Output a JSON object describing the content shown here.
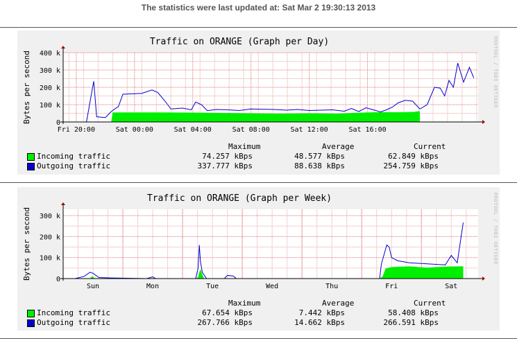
{
  "status": "The statistics were last updated at: Sat Mar 2 19:30:13 2013",
  "credit": "RRDTOOL / TOBI OETIKER",
  "legend_headers": {
    "max": "Maximum",
    "avg": "Average",
    "cur": "Current"
  },
  "colors": {
    "incoming": "#00ee00",
    "outgoing": "#0000cc",
    "grid": "#e8a0a0",
    "panel": "#f0f0f0"
  },
  "graphs": [
    {
      "title": "Traffic on ORANGE (Graph per Day)",
      "ylabel": "Bytes per second",
      "incoming": {
        "label": "Incoming traffic",
        "max": "74.257 kBps",
        "avg": "48.577 kBps",
        "cur": "62.849 kBps"
      },
      "outgoing": {
        "label": "Outgoing traffic",
        "max": "337.777 kBps",
        "avg": "88.638 kBps",
        "cur": "254.759 kBps"
      }
    },
    {
      "title": "Traffic on ORANGE (Graph per Week)",
      "ylabel": "Bytes per second",
      "incoming": {
        "label": "Incoming traffic",
        "max": "67.654 kBps",
        "avg": "7.442 kBps",
        "cur": "58.408 kBps"
      },
      "outgoing": {
        "label": "Outgoing traffic",
        "max": "267.766 kBps",
        "avg": "14.662 kBps",
        "cur": "266.591 kBps"
      }
    }
  ],
  "chart_data": [
    {
      "type": "area",
      "title": "Traffic on ORANGE (Graph per Day)",
      "ylabel": "Bytes per second",
      "ylim": [
        0,
        400000
      ],
      "y_ticks": [
        "0",
        "100 k",
        "200 k",
        "300 k",
        "400 k"
      ],
      "x_ticks": [
        "Fri 20:00",
        "Sat 00:00",
        "Sat 04:00",
        "Sat 08:00",
        "Sat 12:00",
        "Sat 16:00"
      ],
      "x_range_hours": [
        -0.9,
        23.6
      ],
      "series": [
        {
          "name": "Incoming traffic",
          "points": [
            [
              0.7,
              0
            ],
            [
              1.2,
              0
            ],
            [
              2.4,
              0
            ],
            [
              2.5,
              55000
            ],
            [
              4,
              55000
            ],
            [
              6,
              55000
            ],
            [
              8,
              54000
            ],
            [
              10,
              52000
            ],
            [
              12,
              50000
            ],
            [
              14,
              48000
            ],
            [
              16,
              50000
            ],
            [
              18,
              48000
            ],
            [
              19,
              52000
            ],
            [
              20,
              55000
            ],
            [
              21,
              57000
            ],
            [
              22,
              56000
            ],
            [
              23.2,
              58000
            ],
            [
              23.6,
              62849
            ]
          ]
        },
        {
          "name": "Outgoing traffic",
          "points": [
            [
              0.7,
              0
            ],
            [
              1.2,
              235000
            ],
            [
              1.4,
              30000
            ],
            [
              2,
              25000
            ],
            [
              2.4,
              60000
            ],
            [
              2.9,
              90000
            ],
            [
              3.2,
              160000
            ],
            [
              4.5,
              165000
            ],
            [
              5.2,
              185000
            ],
            [
              5.6,
              170000
            ],
            [
              6.1,
              120000
            ],
            [
              6.5,
              75000
            ],
            [
              7.3,
              80000
            ],
            [
              7.9,
              70000
            ],
            [
              8.2,
              115000
            ],
            [
              8.6,
              100000
            ],
            [
              9,
              65000
            ],
            [
              9.6,
              72000
            ],
            [
              10.4,
              70000
            ],
            [
              11.2,
              66000
            ],
            [
              12,
              75000
            ],
            [
              13.6,
              72000
            ],
            [
              14.4,
              68000
            ],
            [
              15.2,
              72000
            ],
            [
              16,
              66000
            ],
            [
              17.6,
              70000
            ],
            [
              18.4,
              62000
            ],
            [
              18.9,
              78000
            ],
            [
              19.4,
              60000
            ],
            [
              19.9,
              82000
            ],
            [
              20.4,
              70000
            ],
            [
              20.9,
              58000
            ],
            [
              21.3,
              70000
            ],
            [
              21.7,
              85000
            ],
            [
              22.1,
              110000
            ],
            [
              22.6,
              125000
            ],
            [
              23.1,
              120000
            ],
            [
              23.6,
              75000
            ],
            [
              24.1,
              100000
            ],
            [
              24.6,
              200000
            ],
            [
              25,
              195000
            ],
            [
              25.3,
              150000
            ],
            [
              25.6,
              240000
            ],
            [
              25.9,
              200000
            ],
            [
              26.2,
              340000
            ],
            [
              26.6,
              230000
            ],
            [
              27,
              315000
            ],
            [
              27.3,
              254759
            ]
          ]
        }
      ]
    },
    {
      "type": "area",
      "title": "Traffic on ORANGE (Graph per Week)",
      "ylabel": "Bytes per second",
      "ylim": [
        0,
        330000
      ],
      "y_ticks": [
        "0",
        "100 k",
        "200 k",
        "300 k"
      ],
      "x_ticks": [
        "Sun",
        "Mon",
        "Tue",
        "Wed",
        "Thu",
        "Fri",
        "Sat"
      ],
      "series": [
        {
          "name": "Incoming traffic",
          "points": [
            [
              0.7,
              0
            ],
            [
              0.95,
              0
            ],
            [
              0.97,
              8000
            ],
            [
              1.0,
              10000
            ],
            [
              1.03,
              0
            ],
            [
              2.7,
              0
            ],
            [
              2.76,
              5000
            ],
            [
              2.78,
              30000
            ],
            [
              2.8,
              45000
            ],
            [
              2.83,
              20000
            ],
            [
              2.86,
              0
            ],
            [
              5.8,
              0
            ],
            [
              5.85,
              10000
            ],
            [
              5.9,
              48000
            ],
            [
              6.0,
              55000
            ],
            [
              6.3,
              58000
            ],
            [
              6.6,
              52000
            ],
            [
              6.9,
              57000
            ],
            [
              7.2,
              58408
            ]
          ]
        },
        {
          "name": "Outgoing traffic",
          "points": [
            [
              0.7,
              0
            ],
            [
              0.85,
              10000
            ],
            [
              0.95,
              30000
            ],
            [
              1.0,
              25000
            ],
            [
              1.1,
              5000
            ],
            [
              1.3,
              3000
            ],
            [
              1.9,
              0
            ],
            [
              2.0,
              8000
            ],
            [
              2.05,
              0
            ],
            [
              2.72,
              0
            ],
            [
              2.76,
              50000
            ],
            [
              2.78,
              160000
            ],
            [
              2.8,
              80000
            ],
            [
              2.83,
              30000
            ],
            [
              2.9,
              0
            ],
            [
              3.2,
              0
            ],
            [
              3.25,
              15000
            ],
            [
              3.35,
              12000
            ],
            [
              3.4,
              0
            ],
            [
              5.8,
              0
            ],
            [
              5.83,
              70000
            ],
            [
              5.88,
              120000
            ],
            [
              5.92,
              160000
            ],
            [
              5.96,
              150000
            ],
            [
              6.0,
              100000
            ],
            [
              6.1,
              85000
            ],
            [
              6.3,
              75000
            ],
            [
              6.6,
              70000
            ],
            [
              6.9,
              65000
            ],
            [
              7.0,
              110000
            ],
            [
              7.1,
              75000
            ],
            [
              7.2,
              266591
            ]
          ]
        }
      ]
    }
  ]
}
